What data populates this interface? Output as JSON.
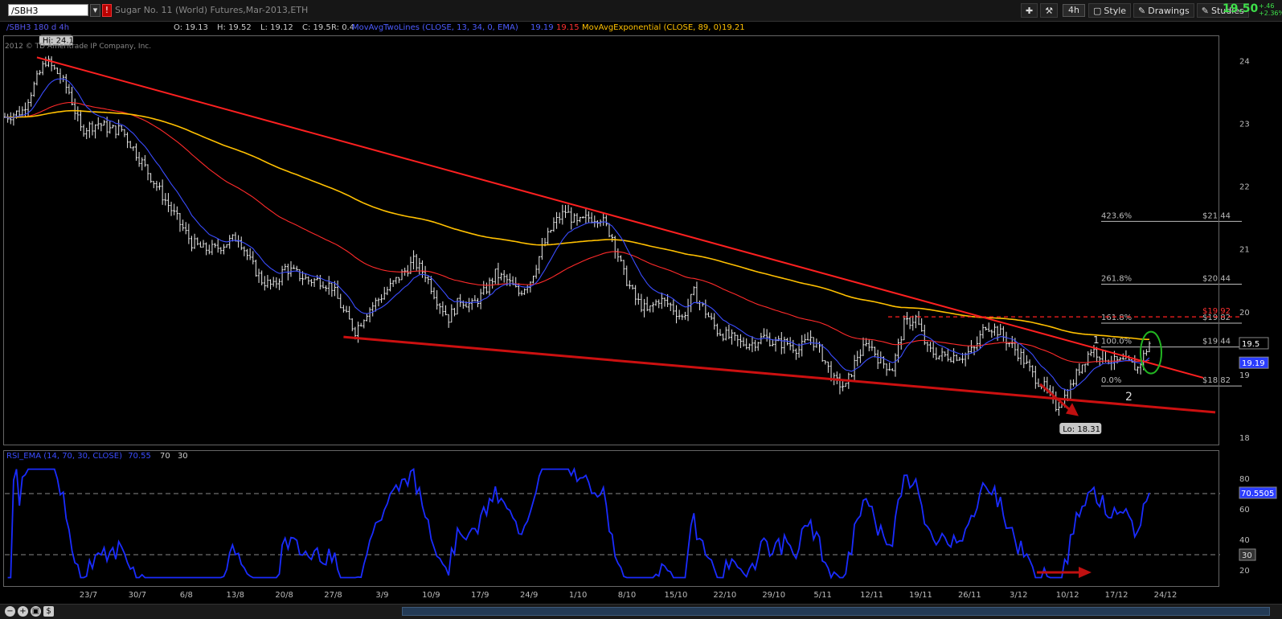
{
  "topbar": {
    "symbol": "/SBH3",
    "description": "Sugar No. 11 (World) Futures,Mar-2013,ETH",
    "aggregation": "4h",
    "style_label": "Style",
    "drawings_label": "Drawings",
    "studies_label": "Studies",
    "last_price": "19.50",
    "net_change": "+.46",
    "pct_change": "+2.36%"
  },
  "infobar": {
    "chart_label": "/SBH3 180 d 4h",
    "open": "O: 19.13",
    "high": "H: 19.52",
    "low": "L: 19.12",
    "close": "C: 19.5",
    "range": "R: 0.4",
    "mov_two_lines": "MovAvgTwoLines (CLOSE, 13, 34, 0, EMA)",
    "mov_two_val1": "19.19",
    "mov_two_val2": "19.15",
    "mov_exp": "MovAvgExponential (CLOSE, 89, 0)",
    "mov_exp_val": "19.21",
    "copyright": "2012 © TD Ameritrade IP Company, Inc."
  },
  "price_panel": {
    "hi_label": "Hi: 24.1",
    "lo_label": "Lo: 18.31",
    "wave_1": "1",
    "wave_2": "2",
    "price_tag": "19.5",
    "ema_tag": "19.19",
    "fib_pct": [
      "423.6%",
      "261.8%",
      "161.8%",
      "100.0%",
      "0.0%"
    ],
    "fib_val": [
      "$21.44",
      "$20.44",
      "$19.82",
      "$19.44",
      "$18.82"
    ],
    "resistance_label": "$19.92"
  },
  "rsi_panel": {
    "title": "RSI_EMA (14, 70, 30, CLOSE)",
    "value": "70.55",
    "overbought": "70",
    "oversold": "30",
    "value_tag": "70.5505",
    "level_tag": "30"
  },
  "colors": {
    "ema_fast": "#3a4cff",
    "ema_slow": "#ff2a2a",
    "ema_89": "#ffc000",
    "trendline": "#ff2020",
    "support": "#cc1010",
    "rsi": "#1a2cff",
    "up_text": "#3ee04a"
  },
  "chart_data": [
    {
      "type": "candlestick",
      "title": "/SBH3 180 d 4h",
      "x_tick_labels": [
        "23/7",
        "30/7",
        "6/8",
        "13/8",
        "20/8",
        "27/8",
        "3/9",
        "10/9",
        "17/9",
        "24/9",
        "1/10",
        "8/10",
        "15/10",
        "22/10",
        "29/10",
        "5/11",
        "12/11",
        "19/11",
        "26/11",
        "3/12",
        "10/12",
        "17/12",
        "24/12"
      ],
      "y_tick_labels": [
        "24",
        "23",
        "22",
        "21",
        "20",
        "19",
        "18"
      ],
      "ylim": [
        17.9,
        24.4
      ],
      "close_path": [
        [
          0,
          23.1
        ],
        [
          3,
          23.2
        ],
        [
          5,
          23.6
        ],
        [
          7,
          24.0
        ],
        [
          9,
          23.8
        ],
        [
          11,
          23.5
        ],
        [
          13,
          22.9
        ],
        [
          16,
          23.0
        ],
        [
          18,
          22.9
        ],
        [
          20,
          22.9
        ],
        [
          22,
          22.6
        ],
        [
          24,
          22.3
        ],
        [
          26,
          22.0
        ],
        [
          28,
          21.7
        ],
        [
          30,
          21.4
        ],
        [
          32,
          21.1
        ],
        [
          34,
          21.0
        ],
        [
          36,
          21.0
        ],
        [
          38,
          21.1
        ],
        [
          40,
          21.2
        ],
        [
          42,
          20.8
        ],
        [
          44,
          20.5
        ],
        [
          46,
          20.4
        ],
        [
          48,
          20.7
        ],
        [
          50,
          20.6
        ],
        [
          52,
          20.5
        ],
        [
          54,
          20.5
        ],
        [
          56,
          20.4
        ],
        [
          58,
          20.0
        ],
        [
          60,
          19.7
        ],
        [
          62,
          20.0
        ],
        [
          64,
          20.2
        ],
        [
          66,
          20.4
        ],
        [
          68,
          20.6
        ],
        [
          70,
          20.8
        ],
        [
          72,
          20.6
        ],
        [
          74,
          20.2
        ],
        [
          76,
          19.9
        ],
        [
          78,
          20.2
        ],
        [
          80,
          20.1
        ],
        [
          82,
          20.3
        ],
        [
          84,
          20.6
        ],
        [
          86,
          20.5
        ],
        [
          88,
          20.3
        ],
        [
          90,
          20.5
        ],
        [
          92,
          21.0
        ],
        [
          94,
          21.4
        ],
        [
          96,
          21.6
        ],
        [
          98,
          21.4
        ],
        [
          100,
          21.5
        ],
        [
          102,
          21.5
        ],
        [
          104,
          21.2
        ],
        [
          106,
          20.6
        ],
        [
          108,
          20.2
        ],
        [
          110,
          20.0
        ],
        [
          112,
          20.2
        ],
        [
          114,
          20.1
        ],
        [
          116,
          19.9
        ],
        [
          118,
          20.3
        ],
        [
          120,
          20.0
        ],
        [
          122,
          19.7
        ],
        [
          124,
          19.6
        ],
        [
          126,
          19.5
        ],
        [
          128,
          19.5
        ],
        [
          130,
          19.6
        ],
        [
          132,
          19.5
        ],
        [
          134,
          19.5
        ],
        [
          136,
          19.4
        ],
        [
          138,
          19.6
        ],
        [
          140,
          19.3
        ],
        [
          142,
          18.9
        ],
        [
          144,
          18.8
        ],
        [
          146,
          19.3
        ],
        [
          148,
          19.5
        ],
        [
          150,
          19.2
        ],
        [
          152,
          19.1
        ],
        [
          154,
          19.8
        ],
        [
          156,
          19.9
        ],
        [
          158,
          19.4
        ],
        [
          160,
          19.3
        ],
        [
          162,
          19.3
        ],
        [
          164,
          19.3
        ],
        [
          166,
          19.4
        ],
        [
          168,
          19.8
        ],
        [
          170,
          19.7
        ],
        [
          172,
          19.5
        ],
        [
          174,
          19.3
        ],
        [
          176,
          19.0
        ],
        [
          178,
          18.8
        ],
        [
          180,
          18.5
        ],
        [
          182,
          18.7
        ],
        [
          184,
          19.1
        ],
        [
          186,
          19.4
        ],
        [
          188,
          19.3
        ],
        [
          190,
          19.2
        ],
        [
          192,
          19.2
        ],
        [
          194,
          19.1
        ],
        [
          196,
          19.5
        ]
      ],
      "ema13_end": 19.19,
      "ema34_end": 19.15,
      "ema89_end": 19.21,
      "hi": 24.1,
      "lo": 18.31
    },
    {
      "type": "line",
      "title": "RSI_EMA (14, 70, 30, CLOSE)",
      "y_tick_labels": [
        "80",
        "60",
        "40",
        "20"
      ],
      "ylim": [
        10,
        90
      ],
      "hlines": [
        70,
        30
      ],
      "last": 70.5505
    }
  ]
}
